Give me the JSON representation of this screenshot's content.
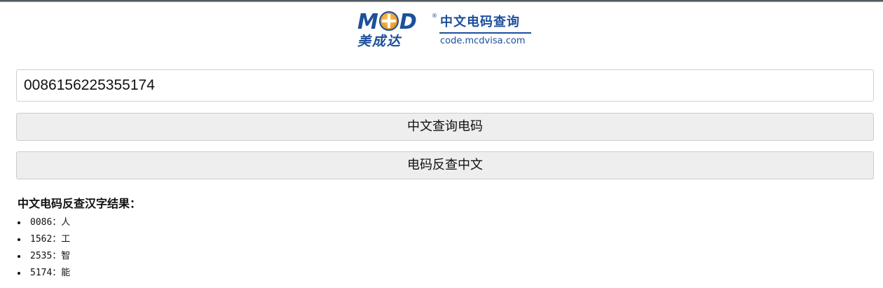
{
  "logo": {
    "brand": "MCD",
    "brand_before_o": "M",
    "brand_after_o": "D",
    "registered_mark": "®",
    "chinese_name": "美成达",
    "title": "中文电码查询",
    "url": "code.mcdvisa.com",
    "brand_color": "#1d4f9b",
    "accent_color": "#e5962a"
  },
  "search": {
    "value": "0086156225355174"
  },
  "buttons": {
    "cn_to_code": "中文查询电码",
    "code_to_cn": "电码反查中文"
  },
  "result": {
    "title": "中文电码反查汉字结果：",
    "items": [
      {
        "text": "0086：人"
      },
      {
        "text": "1562：工"
      },
      {
        "text": "2535：智"
      },
      {
        "text": "5174：能"
      }
    ]
  }
}
